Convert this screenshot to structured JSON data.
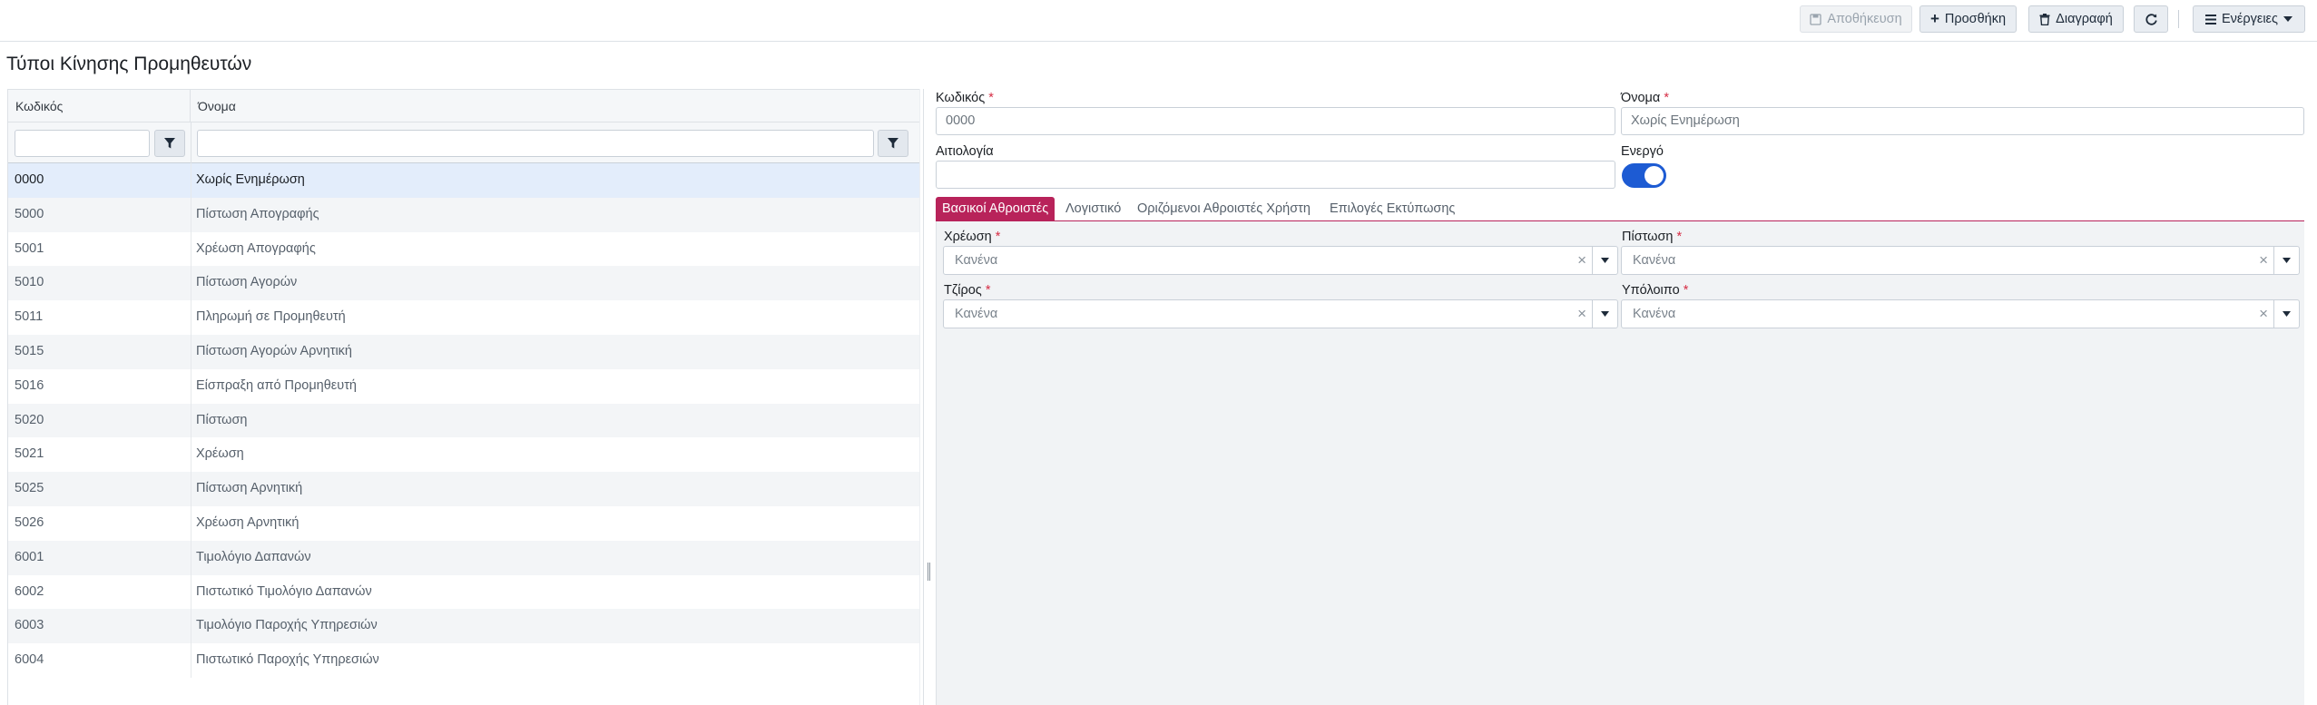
{
  "toolbar": {
    "save_label": "Αποθήκευση",
    "add_label": "Προσθήκη",
    "delete_label": "Διαγραφή",
    "actions_label": "Ενέργειες"
  },
  "page": {
    "title": "Τύποι Κίνησης Προμηθευτών"
  },
  "grid": {
    "columns": [
      "Κωδικός",
      "Όνομα"
    ],
    "rows": [
      {
        "code": "0000",
        "name": "Χωρίς Ενημέρωση",
        "selected": true
      },
      {
        "code": "5000",
        "name": "Πίστωση Απογραφής"
      },
      {
        "code": "5001",
        "name": "Χρέωση Απογραφής"
      },
      {
        "code": "5010",
        "name": "Πίστωση Αγορών"
      },
      {
        "code": "5011",
        "name": "Πληρωμή σε Προμηθευτή"
      },
      {
        "code": "5015",
        "name": "Πίστωση Αγορών Αρνητική"
      },
      {
        "code": "5016",
        "name": "Είσπραξη από Προμηθευτή"
      },
      {
        "code": "5020",
        "name": "Πίστωση"
      },
      {
        "code": "5021",
        "name": "Χρέωση"
      },
      {
        "code": "5025",
        "name": "Πίστωση Αρνητική"
      },
      {
        "code": "5026",
        "name": "Χρέωση Αρνητική"
      },
      {
        "code": "6001",
        "name": "Τιμολόγιο Δαπανών"
      },
      {
        "code": "6002",
        "name": "Πιστωτικό Τιμολόγιο Δαπανών"
      },
      {
        "code": "6003",
        "name": "Τιμολόγιο Παροχής Υπηρεσιών"
      },
      {
        "code": "6004",
        "name": "Πιστωτικό Παροχής Υπηρεσιών"
      }
    ]
  },
  "form": {
    "code_label": "Κωδικός",
    "code_value": "0000",
    "name_label": "Όνομα",
    "name_value": "Χωρίς Ενημέρωση",
    "reason_label": "Αιτιολογία",
    "reason_value": "",
    "active_label": "Ενεργό",
    "active": true,
    "required_mark": "*"
  },
  "tabs": [
    {
      "label": "Βασικοί Αθροιστές",
      "active": true
    },
    {
      "label": "Λογιστικό"
    },
    {
      "label": "Οριζόμενοι Αθροιστές Χρήστη"
    },
    {
      "label": "Επιλογές Εκτύπωσης"
    }
  ],
  "totals": {
    "debit_label": "Χρέωση",
    "credit_label": "Πίστωση",
    "turnover_label": "Τζίρος",
    "balance_label": "Υπόλοιπο",
    "none_value": "Κανένα",
    "clear_glyph": "×"
  },
  "colors": {
    "accent": "#b8235a",
    "toggle": "#1d5bd3",
    "required": "#d62d45"
  }
}
